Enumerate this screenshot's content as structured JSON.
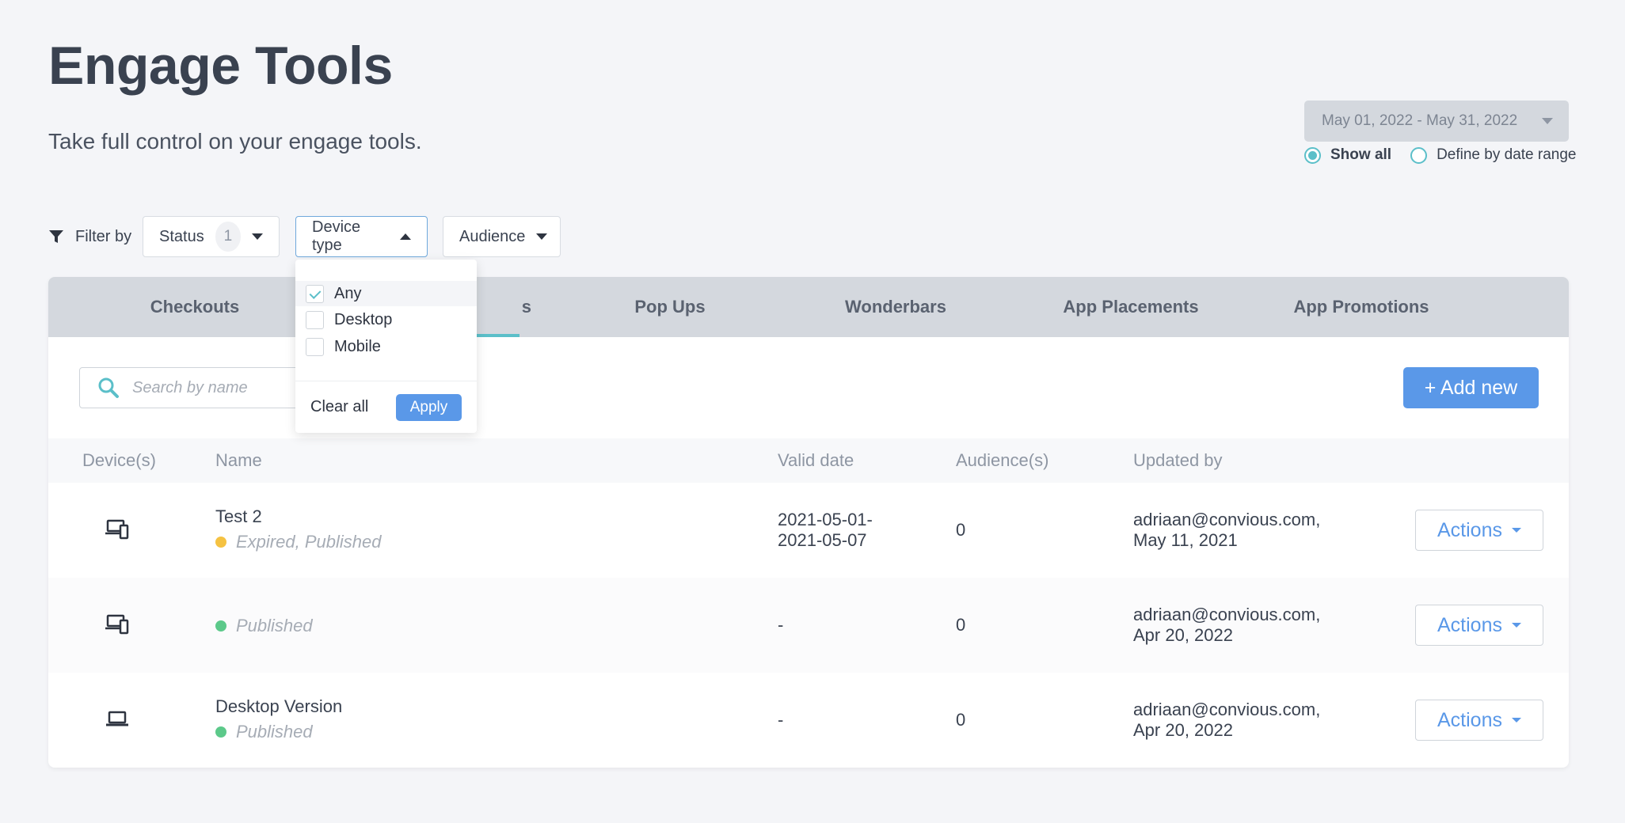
{
  "page": {
    "title": "Engage Tools",
    "subtitle": "Take full control on your engage tools."
  },
  "date_filter": {
    "range": "May 01, 2022 - May 31, 2022",
    "options": [
      "Show all",
      "Define by date range"
    ],
    "selected": "Show all"
  },
  "filters": {
    "label": "Filter by",
    "status": {
      "label": "Status",
      "count": "1"
    },
    "device_type": {
      "label": "Device type",
      "open": true
    },
    "audience": {
      "label": "Audience"
    }
  },
  "device_dropdown": {
    "options": [
      {
        "label": "Any",
        "checked": true
      },
      {
        "label": "Desktop",
        "checked": false
      },
      {
        "label": "Mobile",
        "checked": false
      }
    ],
    "clear_label": "Clear all",
    "apply_label": "Apply"
  },
  "tabs": [
    {
      "label": "Checkouts",
      "active": false
    },
    {
      "label": "s",
      "active": true
    },
    {
      "label": "Pop Ups",
      "active": false
    },
    {
      "label": "Wonderbars",
      "active": false
    },
    {
      "label": "App Placements",
      "active": false
    },
    {
      "label": "App Promotions",
      "active": false
    }
  ],
  "toolbar": {
    "search_placeholder": "Search by name",
    "add_label": "+ Add new"
  },
  "table": {
    "columns": [
      "Device(s)",
      "Name",
      "Valid date",
      "Audience(s)",
      "Updated by"
    ],
    "rows": [
      {
        "device_icon": "multi-device-icon",
        "name": "Test 2",
        "status": "Expired, Published",
        "status_color": "#f5c242",
        "valid_line1": "2021-05-01-",
        "valid_line2": "2021-05-07",
        "audience": "0",
        "updated_line1": "adriaan@convious.com,",
        "updated_line2": "May 11, 2021",
        "action_label": "Actions"
      },
      {
        "device_icon": "multi-device-icon",
        "name": "",
        "status": "Published",
        "status_color": "#5cc98a",
        "valid_line1": "-",
        "valid_line2": "",
        "audience": "0",
        "updated_line1": "adriaan@convious.com,",
        "updated_line2": "Apr 20, 2022",
        "action_label": "Actions"
      },
      {
        "device_icon": "laptop-icon",
        "name": "Desktop Version",
        "status": "Published",
        "status_color": "#5cc98a",
        "valid_line1": "-",
        "valid_line2": "",
        "audience": "0",
        "updated_line1": "adriaan@convious.com,",
        "updated_line2": "Apr 20, 2022",
        "action_label": "Actions"
      }
    ]
  },
  "colors": {
    "accent_teal": "#5bbfc9",
    "primary_blue": "#5a98e8"
  }
}
